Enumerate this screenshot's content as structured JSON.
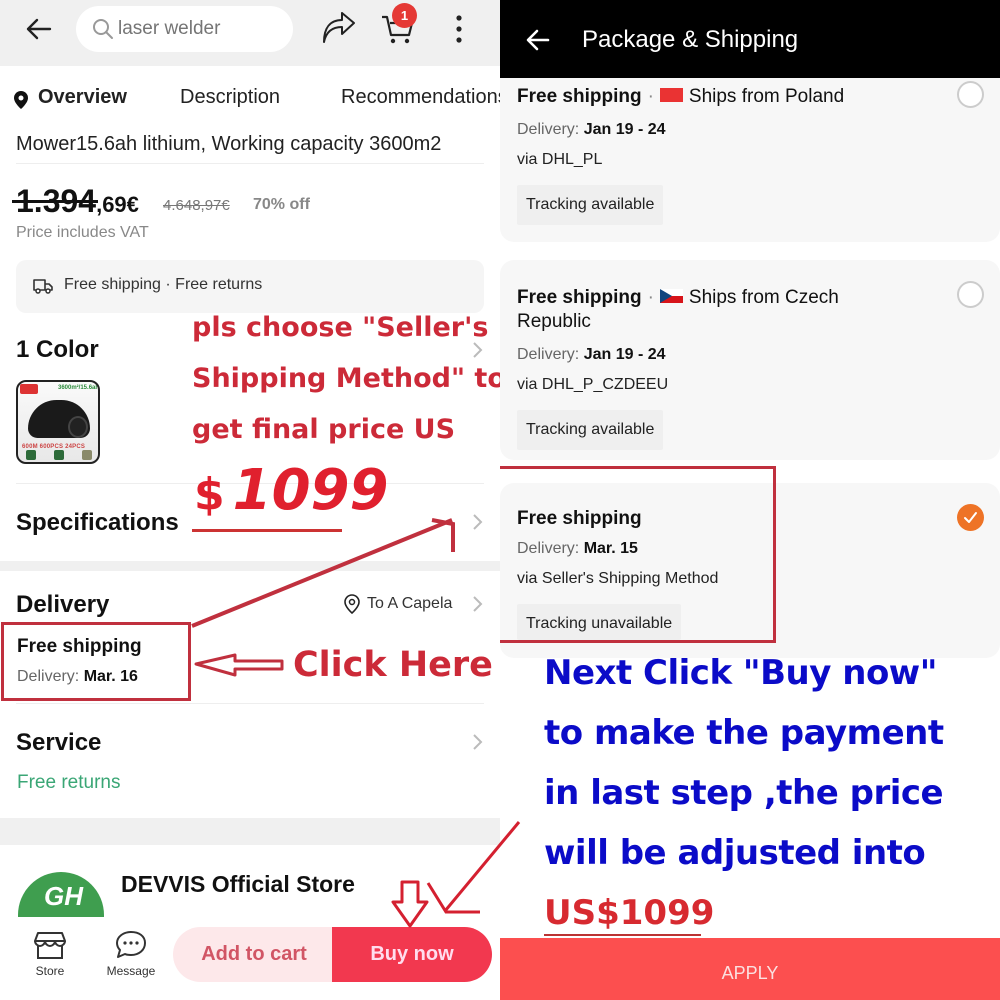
{
  "left": {
    "search": {
      "placeholder": "laser welder"
    },
    "cart_count": "1",
    "tabs": [
      {
        "label": "Overview",
        "active": true
      },
      {
        "label": "Description",
        "active": false
      },
      {
        "label": "Recommendations",
        "active": false
      }
    ],
    "product_title_fragment": "Mower15.6ah lithium, Working capacity 3600m2",
    "price": {
      "main": "1.394",
      "cents": ",69€",
      "original": "4.648,97€",
      "discount": "70% off",
      "vat_note": "Price includes VAT"
    },
    "shipping_summary": "Free shipping · Free returns",
    "color_section": {
      "title": "1 Color",
      "thumb_caption": "3600m²/15.6ah",
      "thumb_bottom": "600M  600PCS  24PCS"
    },
    "specifications_title": "Specifications",
    "delivery": {
      "title": "Delivery",
      "destination": "To A Capela",
      "shipping": "Free shipping",
      "date_label": "Delivery:",
      "date_value": "Mar. 16"
    },
    "service": {
      "title": "Service",
      "subtitle": "Free returns"
    },
    "store": {
      "name": "DEVVIS Official Store",
      "logo_text": "GH"
    },
    "bottom_nav": {
      "store_label": "Store",
      "message_label": "Message",
      "add_to_cart": "Add to cart",
      "buy_now": "Buy now"
    }
  },
  "right": {
    "header_title": "Package & Shipping",
    "options": [
      {
        "shipping": "Free shipping",
        "origin": "Ships from Poland",
        "flag": "poland",
        "date_label": "Delivery:",
        "date_value": "Jan 19 - 24",
        "via": "via DHL_PL",
        "tracking": "Tracking available",
        "selected": false
      },
      {
        "shipping": "Free shipping",
        "origin": "Ships from Czech",
        "origin_line2": "Republic",
        "flag": "czech",
        "date_label": "Delivery:",
        "date_value": "Jan 19 - 24",
        "via": "via DHL_P_CZDEEU",
        "tracking": "Tracking available",
        "selected": false
      },
      {
        "shipping": "Free shipping",
        "date_label": "Delivery:",
        "date_value": "Mar. 15",
        "via": "via Seller's Shipping Method",
        "tracking": "Tracking unavailable",
        "selected": true
      }
    ],
    "apply_label": "APPLY"
  },
  "annotations": {
    "instruction_lines": [
      "pls choose \"Seller's",
      "Shipping Method\" to",
      "get final price US"
    ],
    "price_symbol": "$",
    "price_value": "1099",
    "click_here": "Click Here",
    "next_lines": [
      "Next Click \"Buy now\"",
      "to make the payment",
      "in last step ,the price",
      "will be adjusted into"
    ],
    "final_price": "US$1099"
  },
  "colors": {
    "accent_red": "#f2384f",
    "apply_red": "#fc4f4f",
    "annotation_red": "#cc2a38",
    "annotation_blue": "#0b0bc8",
    "selected_orange": "#ee7326",
    "service_green": "#3aa675"
  }
}
